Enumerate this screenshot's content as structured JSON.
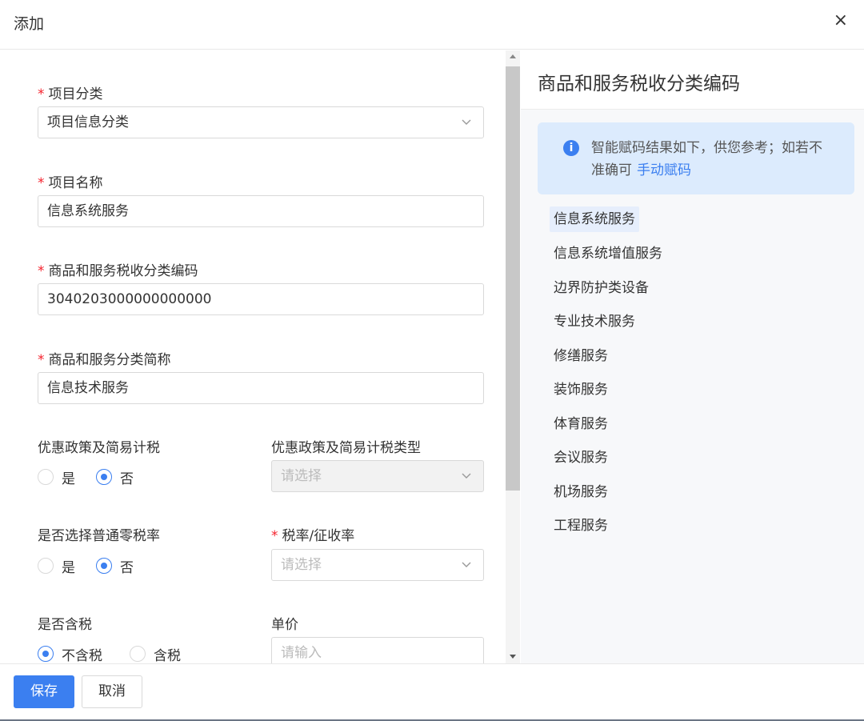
{
  "dialog": {
    "title": "添加",
    "close_symbol": "×"
  },
  "form": {
    "project_category": {
      "label": "项目分类",
      "value": "项目信息分类",
      "required": true
    },
    "project_name": {
      "label": "项目名称",
      "value": "信息系统服务",
      "required": true
    },
    "tax_code": {
      "label": "商品和服务税收分类编码",
      "value": "3040203000000000000",
      "required": true
    },
    "category_short": {
      "label": "商品和服务分类简称",
      "value": "信息技术服务",
      "required": true
    },
    "preferential_policy": {
      "label": "优惠政策及简易计税",
      "options": [
        "是",
        "否"
      ],
      "selected": "否"
    },
    "preferential_type": {
      "label": "优惠政策及简易计税类型",
      "placeholder": "请选择",
      "disabled": true
    },
    "zero_rate": {
      "label": "是否选择普通零税率",
      "options": [
        "是",
        "否"
      ],
      "selected": "否"
    },
    "tax_rate": {
      "label": "税率/征收率",
      "placeholder": "请选择",
      "required": true
    },
    "tax_included": {
      "label": "是否含税",
      "options": [
        "不含税",
        "含税"
      ],
      "selected": "不含税"
    },
    "unit_price": {
      "label": "单价",
      "placeholder": "请输入"
    },
    "required_mark": "*"
  },
  "side_panel": {
    "title": "商品和服务税收分类编码",
    "info_icon": "i",
    "info_text": "智能赋码结果如下，供您参考；如若不准确可",
    "info_link": "手动赋码",
    "codes": [
      "信息系统服务",
      "信息系统增值服务",
      "边界防护类设备",
      "专业技术服务",
      "修缮服务",
      "装饰服务",
      "体育服务",
      "会议服务",
      "机场服务",
      "工程服务"
    ],
    "active_code": "信息系统服务"
  },
  "footer": {
    "save_label": "保存",
    "cancel_label": "取消"
  },
  "colors": {
    "accent": "#3b7ff0",
    "required": "#f5222d",
    "info_bg": "#dcebfd"
  }
}
